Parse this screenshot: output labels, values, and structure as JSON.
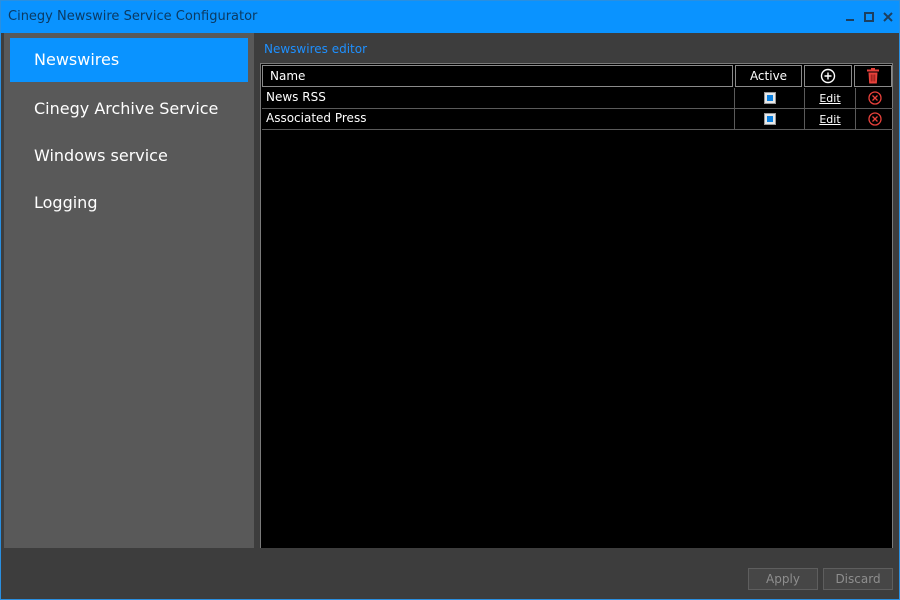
{
  "window": {
    "title": "Cinegy Newswire Service Configurator"
  },
  "sidebar": {
    "items": [
      {
        "label": "Newswires",
        "active": true
      },
      {
        "label": "Cinegy Archive Service",
        "active": false
      },
      {
        "label": "Windows service",
        "active": false
      },
      {
        "label": "Logging",
        "active": false
      }
    ]
  },
  "main": {
    "section_title": "Newswires editor",
    "grid": {
      "headers": {
        "name": "Name",
        "active": "Active",
        "add_icon": "plus-circle-icon",
        "delete_icon": "trash-icon"
      },
      "rows": [
        {
          "name": "News RSS",
          "active": true,
          "edit_label": "Edit"
        },
        {
          "name": "Associated Press",
          "active": true,
          "edit_label": "Edit"
        }
      ]
    }
  },
  "footer": {
    "apply_label": "Apply",
    "discard_label": "Discard"
  },
  "colors": {
    "accent": "#0a93ff",
    "delete": "#e8413b"
  }
}
